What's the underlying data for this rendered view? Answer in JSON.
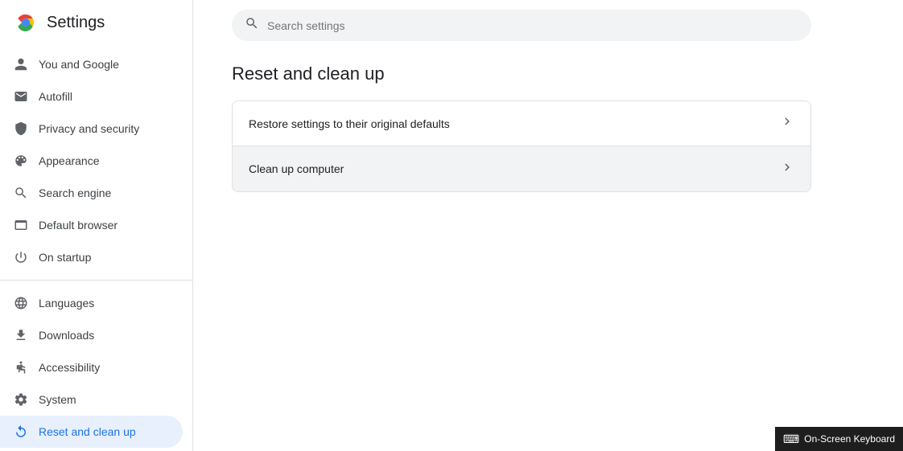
{
  "header": {
    "logo_alt": "Chrome logo",
    "title": "Settings"
  },
  "search": {
    "placeholder": "Search settings"
  },
  "sidebar": {
    "items": [
      {
        "id": "you-and-google",
        "label": "You and Google",
        "icon": "person",
        "active": false
      },
      {
        "id": "autofill",
        "label": "Autofill",
        "icon": "autofill",
        "active": false
      },
      {
        "id": "privacy-security",
        "label": "Privacy and security",
        "icon": "shield",
        "active": false
      },
      {
        "id": "appearance",
        "label": "Appearance",
        "icon": "palette",
        "active": false
      },
      {
        "id": "search-engine",
        "label": "Search engine",
        "icon": "search",
        "active": false
      },
      {
        "id": "default-browser",
        "label": "Default browser",
        "icon": "browser",
        "active": false
      },
      {
        "id": "on-startup",
        "label": "On startup",
        "icon": "power",
        "active": false
      }
    ],
    "items2": [
      {
        "id": "languages",
        "label": "Languages",
        "icon": "globe",
        "active": false
      },
      {
        "id": "downloads",
        "label": "Downloads",
        "icon": "download",
        "active": false
      },
      {
        "id": "accessibility",
        "label": "Accessibility",
        "icon": "accessibility",
        "active": false
      },
      {
        "id": "system",
        "label": "System",
        "icon": "settings",
        "active": false
      },
      {
        "id": "reset-clean",
        "label": "Reset and clean up",
        "icon": "reset",
        "active": true
      }
    ]
  },
  "main": {
    "page_title": "Reset and clean up",
    "settings_rows": [
      {
        "id": "restore-defaults",
        "label": "Restore settings to their original defaults"
      },
      {
        "id": "clean-computer",
        "label": "Clean up computer"
      }
    ]
  },
  "taskbar": {
    "label": "On-Screen Keyboard",
    "icon": "⌨"
  }
}
